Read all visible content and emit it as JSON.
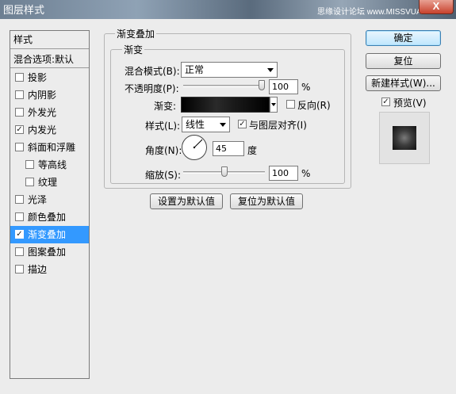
{
  "window": {
    "title": "图层样式",
    "watermark": "思缘设计论坛 www.MISSVUAN.com",
    "close_label": "X"
  },
  "left_panel": {
    "header": "样式",
    "blend_options": "混合选项:默认",
    "items": [
      {
        "label": "投影",
        "checked": false
      },
      {
        "label": "内阴影",
        "checked": false
      },
      {
        "label": "外发光",
        "checked": false
      },
      {
        "label": "内发光",
        "checked": true
      },
      {
        "label": "斜面和浮雕",
        "checked": false
      },
      {
        "label": "等高线",
        "checked": false
      },
      {
        "label": "纹理",
        "checked": false
      },
      {
        "label": "光泽",
        "checked": false
      },
      {
        "label": "颜色叠加",
        "checked": false
      },
      {
        "label": "渐变叠加",
        "checked": true,
        "selected": true
      },
      {
        "label": "图案叠加",
        "checked": false
      },
      {
        "label": "描边",
        "checked": false
      }
    ]
  },
  "gradient_overlay": {
    "section_title": "渐变叠加",
    "group_title": "渐变",
    "blend_mode_label": "混合模式(B):",
    "blend_mode_value": "正常",
    "opacity_label": "不透明度(P):",
    "opacity_value": "100",
    "opacity_percent": 1.0,
    "percent_unit": "%",
    "gradient_label": "渐变:",
    "reverse_label": "反向(R)",
    "reverse_checked": false,
    "style_label": "样式(L):",
    "style_value": "线性",
    "align_label": "与图层对齐(I)",
    "align_checked": true,
    "angle_label": "角度(N):",
    "angle_value": "45",
    "angle_unit": "度",
    "scale_label": "缩放(S):",
    "scale_value": "100",
    "scale_fraction": 0.5,
    "btn_set_default": "设置为默认值",
    "btn_reset_default": "复位为默认值"
  },
  "right_panel": {
    "ok_label": "确定",
    "reset_label": "复位",
    "new_style_label": "新建样式(W)...",
    "preview_label": "预览(V)",
    "preview_checked": true
  },
  "check_mark": "✓"
}
